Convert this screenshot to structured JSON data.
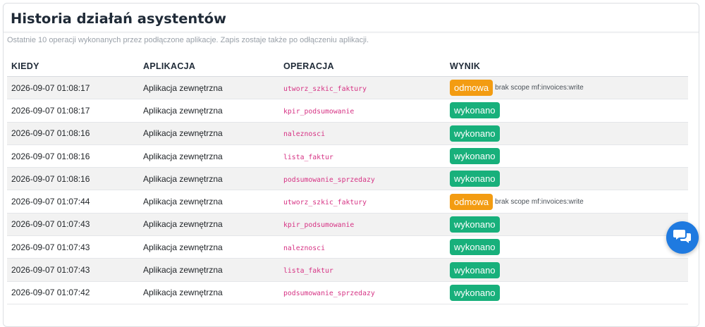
{
  "header": {
    "title": "Historia działań asystentów",
    "description": "Ostatnie 10 operacji wykonanych przez podłączone aplikacje. Zapis zostaje także po odłączeniu aplikacji."
  },
  "table": {
    "columns": [
      "KIEDY",
      "APLIKACJA",
      "OPERACJA",
      "WYNIK"
    ],
    "rows": [
      {
        "when": "2026-09-07 01:08:17",
        "app": "Aplikacja zewnętrzna",
        "operation": "utworz_szkic_faktury",
        "result": "odmowa",
        "status": "deny",
        "note": "brak scope mf:invoices:write"
      },
      {
        "when": "2026-09-07 01:08:17",
        "app": "Aplikacja zewnętrzna",
        "operation": "kpir_podsumowanie",
        "result": "wykonano",
        "status": "ok",
        "note": ""
      },
      {
        "when": "2026-09-07 01:08:16",
        "app": "Aplikacja zewnętrzna",
        "operation": "naleznosci",
        "result": "wykonano",
        "status": "ok",
        "note": ""
      },
      {
        "when": "2026-09-07 01:08:16",
        "app": "Aplikacja zewnętrzna",
        "operation": "lista_faktur",
        "result": "wykonano",
        "status": "ok",
        "note": ""
      },
      {
        "when": "2026-09-07 01:08:16",
        "app": "Aplikacja zewnętrzna",
        "operation": "podsumowanie_sprzedazy",
        "result": "wykonano",
        "status": "ok",
        "note": ""
      },
      {
        "when": "2026-09-07 01:07:44",
        "app": "Aplikacja zewnętrzna",
        "operation": "utworz_szkic_faktury",
        "result": "odmowa",
        "status": "deny",
        "note": "brak scope mf:invoices:write"
      },
      {
        "when": "2026-09-07 01:07:43",
        "app": "Aplikacja zewnętrzna",
        "operation": "kpir_podsumowanie",
        "result": "wykonano",
        "status": "ok",
        "note": ""
      },
      {
        "when": "2026-09-07 01:07:43",
        "app": "Aplikacja zewnętrzna",
        "operation": "naleznosci",
        "result": "wykonano",
        "status": "ok",
        "note": ""
      },
      {
        "when": "2026-09-07 01:07:43",
        "app": "Aplikacja zewnętrzna",
        "operation": "lista_faktur",
        "result": "wykonano",
        "status": "ok",
        "note": ""
      },
      {
        "when": "2026-09-07 01:07:42",
        "app": "Aplikacja zewnętrzna",
        "operation": "podsumowanie_sprzedazy",
        "result": "wykonano",
        "status": "ok",
        "note": ""
      }
    ]
  },
  "chat_button": {
    "icon": "chat-bubbles-icon"
  },
  "colors": {
    "success": "#18b07b",
    "denied": "#f39c12",
    "operation_text": "#d63384",
    "chat_button": "#1f7ae0"
  }
}
